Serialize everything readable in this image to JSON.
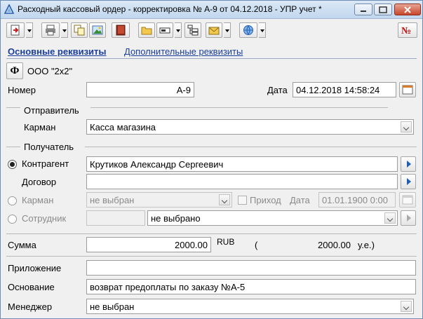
{
  "window": {
    "title": "Расходный кассовый ордер - корректировка № А-9 от 04.12.2018 - УПР учет *"
  },
  "tabs": {
    "main": "Основные реквизиты",
    "additional": "Дополнительные реквизиты"
  },
  "org": {
    "icon_letter": "Ф",
    "name": "ООО \"2х2\""
  },
  "number": {
    "label": "Номер",
    "value": "А-9"
  },
  "date": {
    "label": "Дата",
    "value": "04.12.2018 14:58:24"
  },
  "sender": {
    "section_label": "Отправитель",
    "pocket_label": "Карман",
    "pocket_value": "Касса магазина"
  },
  "receiver": {
    "section_label": "Получатель",
    "counterparty_label": "Контрагент",
    "counterparty_value": "Крутиков Александр Сергеевич",
    "contract_label": "Договор",
    "contract_value": "",
    "pocket_label": "Карман",
    "pocket_value": "не выбран",
    "income_label": "Приход",
    "income_date_label": "Дата",
    "income_date_value": "01.01.1900 0:00",
    "employee_label": "Сотрудник",
    "employee_value": "не выбрано"
  },
  "sum": {
    "label": "Сумма",
    "value": "2000.00",
    "currency": "RUB",
    "open_paren": "(",
    "ue_value": "2000.00",
    "ue_suffix": "у.е.)"
  },
  "attachment": {
    "label": "Приложение",
    "value": ""
  },
  "basis": {
    "label": "Основание",
    "value": "возврат предоплаты по заказу №А-5"
  },
  "manager": {
    "label": "Менеджер",
    "value": "не выбран"
  },
  "colors": {
    "link": "#1a3e9c",
    "window_bg": "#f0f0f0",
    "close_btn": "#c7462b"
  }
}
